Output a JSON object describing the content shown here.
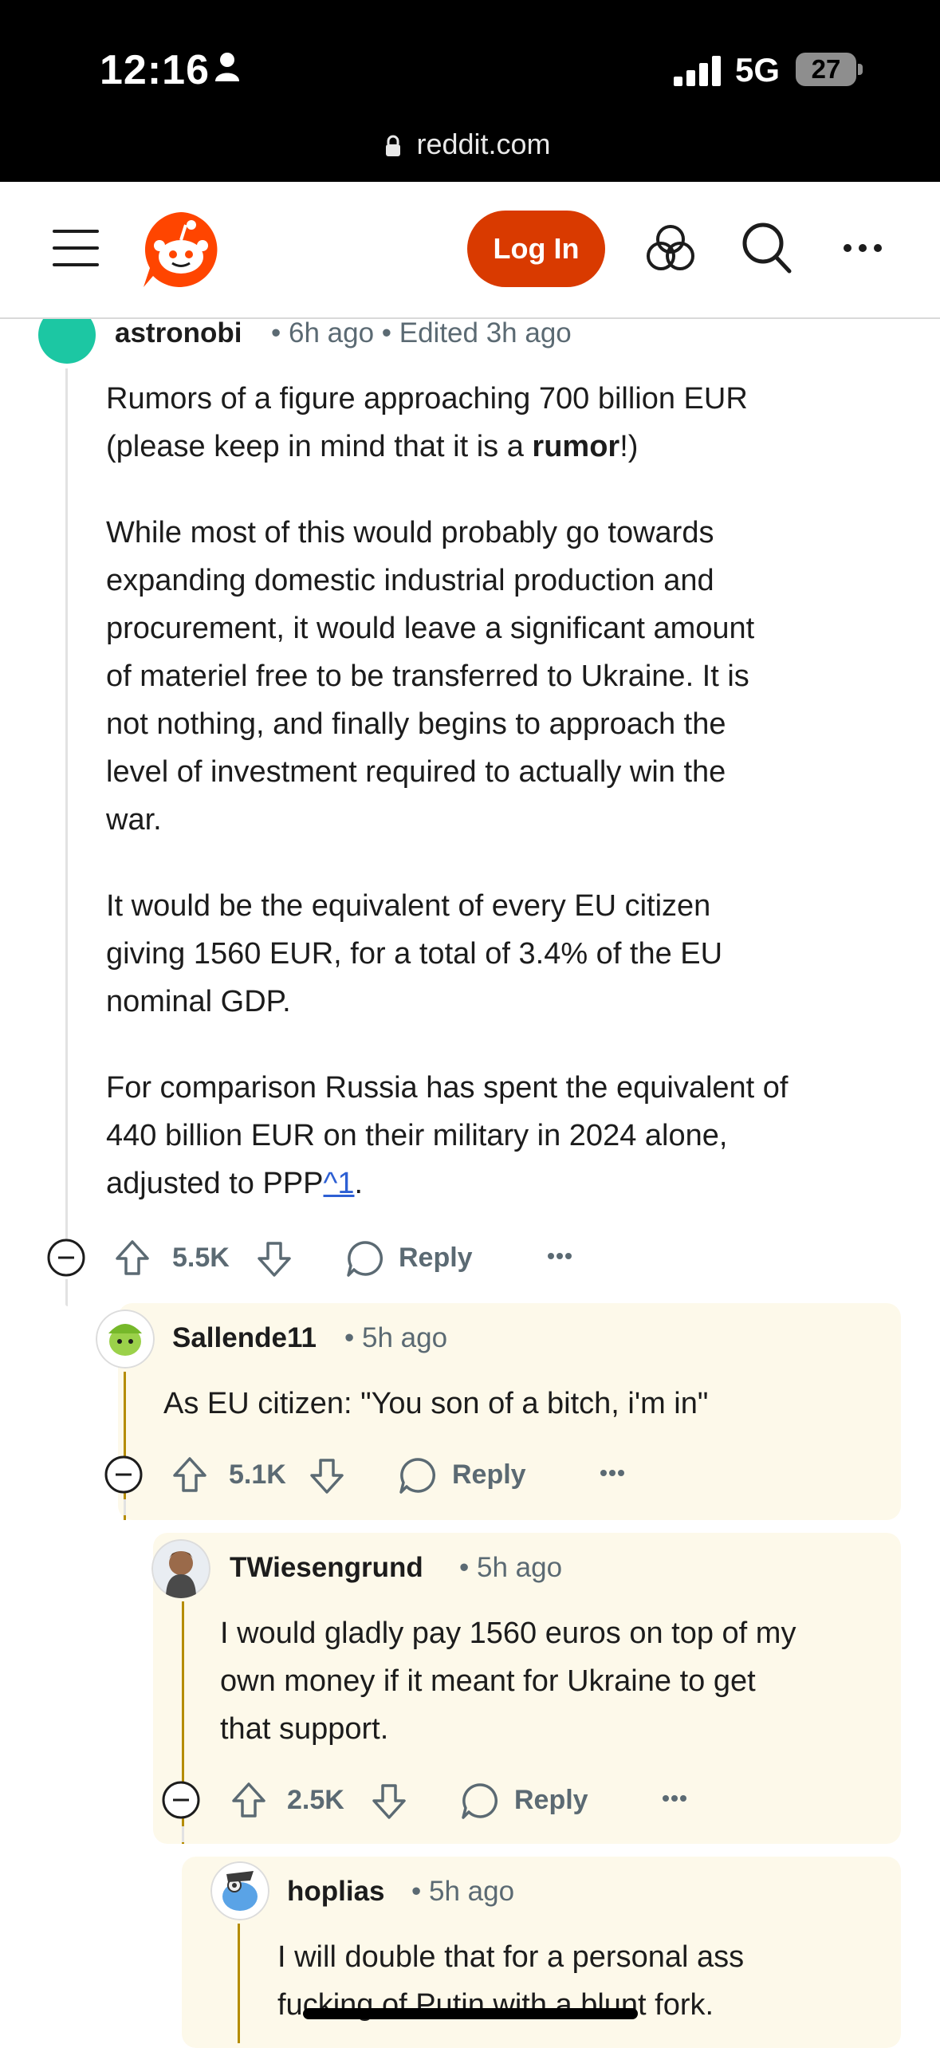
{
  "status": {
    "time": "12:16",
    "network": "5G",
    "battery": "27",
    "url": "reddit.com"
  },
  "header": {
    "login_label": "Log In"
  },
  "comments": [
    {
      "user": "astronobi",
      "meta": "6h ago",
      "edited": "Edited 3h ago",
      "paragraphs": {
        "p1a": "Rumors of a figure approaching 700 billion EUR",
        "p1b_pre": "(please keep in mind that it is a ",
        "p1b_bold": "rumor",
        "p1b_post": "!)",
        "p2": [
          "While most of this would probably go towards",
          "expanding domestic industrial production and",
          "procurement, it would leave a significant amount",
          "of materiel free to be transferred to Ukraine. It is",
          "not nothing, and finally begins to approach the",
          "level of investment required to actually win the",
          "war."
        ],
        "p3": [
          "It would be the equivalent of every EU citizen",
          "giving 1560 EUR, for a total of 3.4% of the EU",
          "nominal GDP."
        ],
        "p4a": "For comparison Russia has spent the equivalent of",
        "p4b": "440 billion EUR on their military in 2024 alone,",
        "p4c_pre": "adjusted to PPP",
        "p4c_link": "^1",
        "p4c_post": "."
      },
      "votes": "5.5K",
      "reply_label": "Reply"
    },
    {
      "user": "Sallende11",
      "meta": "5h ago",
      "text": "As EU citizen: \"You son of a bitch, i'm in\"",
      "votes": "5.1K",
      "reply_label": "Reply"
    },
    {
      "user": "TWiesengrund",
      "meta": "5h ago",
      "lines": [
        "I would gladly pay 1560 euros on top of my",
        "own money if it meant for Ukraine to get",
        "that support."
      ],
      "votes": "2.5K",
      "reply_label": "Reply"
    },
    {
      "user": "hoplias",
      "meta": "5h ago",
      "lines": [
        "I will double that for a personal ass",
        "fucking of Putin with a blunt fork."
      ]
    }
  ],
  "colors": {
    "accent": "#d93a00",
    "highlight_bg": "#fdf9ea",
    "thread_line": "#b58c00",
    "link": "#2d5fd3"
  }
}
